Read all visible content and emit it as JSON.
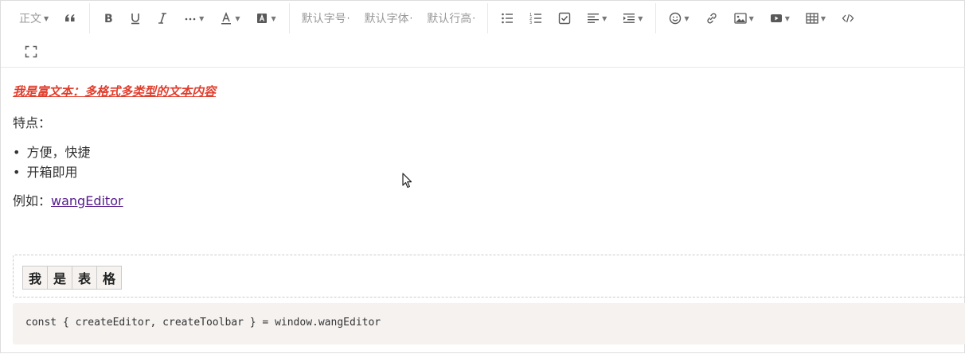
{
  "toolbar": {
    "row1": [
      {
        "name": "paragraph-format-select",
        "label": "正文",
        "caret": true,
        "text": true
      },
      {
        "name": "blockquote-button",
        "icon": "quote-icon"
      },
      {
        "sep": true
      },
      {
        "name": "bold-button",
        "icon": "bold-icon"
      },
      {
        "name": "underline-button",
        "icon": "underline-icon"
      },
      {
        "name": "italic-button",
        "icon": "italic-icon"
      },
      {
        "name": "more-format-button",
        "icon": "ellipsis-icon",
        "caret": true
      },
      {
        "name": "font-color-button",
        "icon": "font-color-icon",
        "caret": true
      },
      {
        "name": "bg-color-button",
        "icon": "bg-color-icon",
        "caret": true
      },
      {
        "sep": true
      },
      {
        "name": "font-size-select",
        "label": "默认字号",
        "text": true,
        "dot": true
      },
      {
        "name": "font-family-select",
        "label": "默认字体",
        "text": true,
        "dot": true
      },
      {
        "name": "line-height-select",
        "label": "默认行高",
        "text": true,
        "dot": true
      },
      {
        "sep": true
      },
      {
        "name": "bulleted-list-button",
        "icon": "bulleted-list-icon"
      },
      {
        "name": "numbered-list-button",
        "icon": "numbered-list-icon"
      },
      {
        "name": "todo-button",
        "icon": "checkbox-icon"
      },
      {
        "name": "align-button",
        "icon": "align-left-icon",
        "caret": true
      },
      {
        "name": "indent-button",
        "icon": "indent-icon",
        "caret": true
      },
      {
        "sep": true
      },
      {
        "name": "emotion-button",
        "icon": "smiley-icon",
        "caret": true
      },
      {
        "name": "insert-link-button",
        "icon": "link-icon"
      },
      {
        "name": "insert-image-button",
        "icon": "image-icon",
        "caret": true
      },
      {
        "name": "insert-video-button",
        "icon": "video-icon",
        "caret": true
      },
      {
        "name": "insert-table-button",
        "icon": "table-icon",
        "caret": true
      },
      {
        "name": "code-block-button",
        "icon": "code-icon"
      }
    ],
    "row2": [
      {
        "name": "fullscreen-button",
        "icon": "fullscreen-icon"
      }
    ]
  },
  "content": {
    "headline": "我是富文本：多格式多类型的文本内容",
    "features_label": "特点：",
    "list": [
      "方便，快捷",
      "开箱即用"
    ],
    "example_prefix": "例如：",
    "example_link": "wangEditor",
    "table_cells": [
      "我",
      "是",
      "表",
      "格"
    ],
    "code": "const { createEditor, createToolbar } = window.wangEditor"
  }
}
